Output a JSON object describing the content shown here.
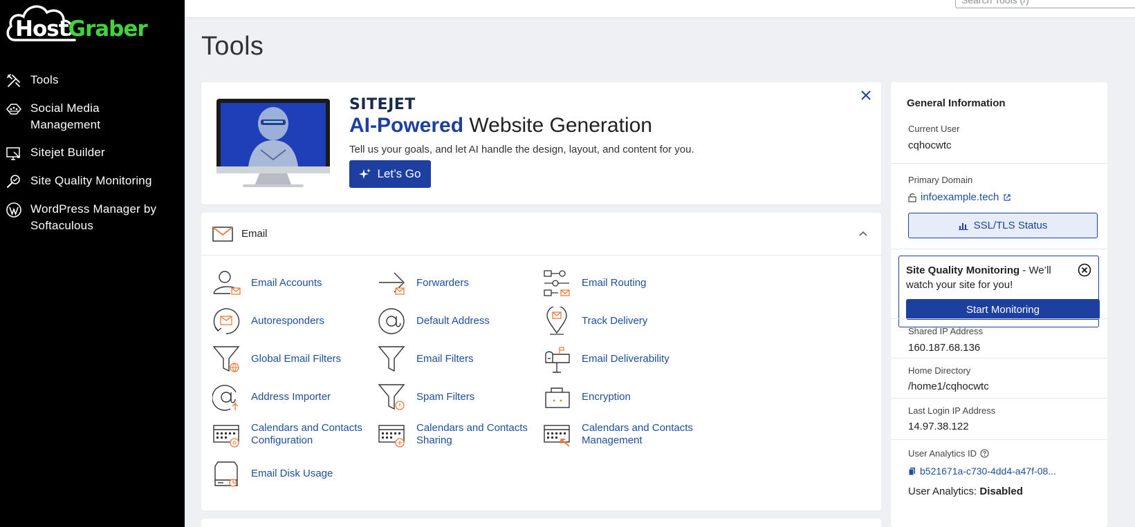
{
  "brand": {
    "host": "Host",
    "graber": "Graber"
  },
  "sidebar": {
    "items": [
      {
        "label": "Tools",
        "icon": "tools-icon"
      },
      {
        "label": "Social Media Management",
        "icon": "social-media-icon"
      },
      {
        "label": "Sitejet Builder",
        "icon": "sitejet-icon"
      },
      {
        "label": "Site Quality Monitoring",
        "icon": "site-quality-icon"
      },
      {
        "label": "WordPress Manager by Softaculous",
        "icon": "wordpress-icon"
      }
    ]
  },
  "search": {
    "placeholder": "Search Tools (/)"
  },
  "page": {
    "title": "Tools"
  },
  "banner": {
    "brand": "SITEJET",
    "headline_accent": "AI-Powered",
    "headline_rest": " Website Generation",
    "subtitle": "Tell us your goals, and let AI handle the design, layout, and content for you.",
    "cta": "Let’s Go"
  },
  "email": {
    "title": "Email",
    "tools": [
      {
        "label": "Email Accounts",
        "icon": "email-accounts-icon"
      },
      {
        "label": "Forwarders",
        "icon": "forwarders-icon"
      },
      {
        "label": "Email Routing",
        "icon": "email-routing-icon"
      },
      {
        "label": "Autoresponders",
        "icon": "autoresponders-icon"
      },
      {
        "label": "Default Address",
        "icon": "default-address-icon"
      },
      {
        "label": "Track Delivery",
        "icon": "track-delivery-icon"
      },
      {
        "label": "Global Email Filters",
        "icon": "global-filter-icon"
      },
      {
        "label": "Email Filters",
        "icon": "email-filter-icon"
      },
      {
        "label": "Email Deliverability",
        "icon": "mailbox-icon"
      },
      {
        "label": "Address Importer",
        "icon": "address-importer-icon"
      },
      {
        "label": "Spam Filters",
        "icon": "spam-filter-icon"
      },
      {
        "label": "Encryption",
        "icon": "encryption-icon"
      },
      {
        "label": "Calendars and Contacts Configuration",
        "icon": "calendar-config-icon"
      },
      {
        "label": "Calendars and Contacts Sharing",
        "icon": "calendar-sharing-icon"
      },
      {
        "label": "Calendars and Contacts Management",
        "icon": "calendar-management-icon"
      },
      {
        "label": "Email Disk Usage",
        "icon": "disk-usage-icon"
      }
    ]
  },
  "info": {
    "title": "General Information",
    "current_user_label": "Current User",
    "current_user": "cqhocwtc",
    "primary_domain_label": "Primary Domain",
    "primary_domain": "infoexample.tech",
    "ssl_button": "SSL/TLS Status",
    "sqm_title": "Site Quality Monitoring",
    "sqm_text": " - We’ll watch your site for you!",
    "sqm_button": "Start Monitoring",
    "shared_ip_label": "Shared IP Address",
    "shared_ip": "160.187.68.136",
    "home_dir_label": "Home Directory",
    "home_dir": "/home1/cqhocwtc",
    "last_login_label": "Last Login IP Address",
    "last_login": "14.97.38.122",
    "analytics_id_label": "User Analytics ID",
    "analytics_id": "b521671a-c730-4dd4-a47f-08...",
    "analytics_label": "User Analytics: ",
    "analytics_state": "Disabled"
  },
  "colors": {
    "accent": "#1d3fa0",
    "brand_green": "#3fd43a",
    "icon_orange": "#f07a3a"
  }
}
